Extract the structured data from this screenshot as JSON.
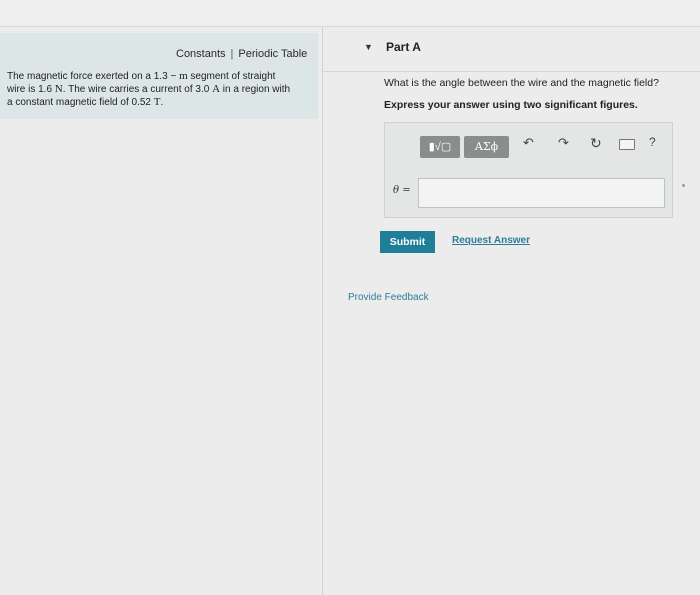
{
  "left_panel": {
    "constants_link": "Constants",
    "separator": "|",
    "periodic_table_link": "Periodic Table",
    "problem": {
      "t1": "The magnetic force exerted on a 1.3",
      "dash": "−",
      "unit_m": "m",
      "t2": " segment of straight",
      "t3": "wire is 1.6 ",
      "unit_N": "N",
      "t4": ". The wire carries a current of 3.0 ",
      "unit_A": "A",
      "t5": " in a region with",
      "t6": "a constant magnetic field of 0.52 ",
      "unit_T": "T",
      "t7": "."
    }
  },
  "part": {
    "caret": "▼",
    "title": "Part A",
    "question": "What is the angle between the wire and the magnetic field?",
    "instruction": "Express your answer using two significant figures."
  },
  "toolbar": {
    "templates_label": "▮√▢",
    "symbols_label": "ΑΣϕ",
    "undo_icon": "↶",
    "redo_icon": "↷",
    "reset_icon": "↻",
    "help_label": "?"
  },
  "answer": {
    "variable_label": "θ =",
    "value": ""
  },
  "actions": {
    "submit_label": "Submit",
    "request_answer_label": "Request Answer",
    "feedback_label": "Provide Feedback"
  },
  "colors": {
    "submit_bg": "#1f7f99",
    "link": "#2f7b9a",
    "info_box_bg": "#dde6e6"
  }
}
